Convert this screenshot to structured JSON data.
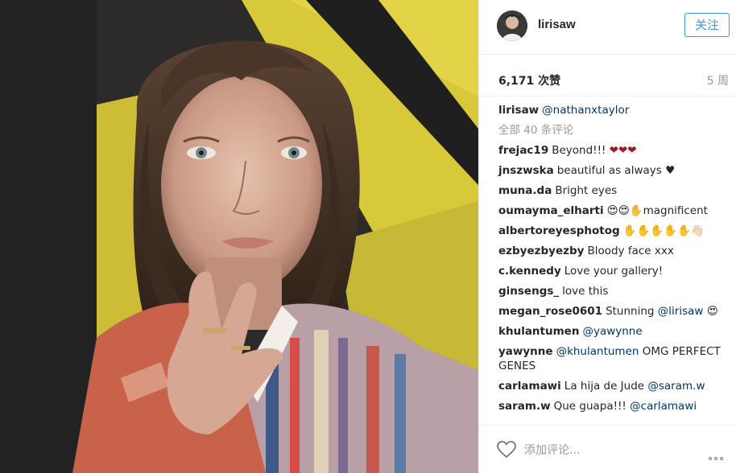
{
  "post": {
    "username": "lirisaw",
    "follow_label": "关注",
    "likes": "6,171 次赞",
    "time": "5 周",
    "caption": {
      "user": "lirisaw",
      "mention": "@nathanxtaylor"
    },
    "load_more": "全部 40 条评论",
    "comments": [
      {
        "user": "frejac19",
        "text": "Beyond!!! ",
        "emoji": "❤❤❤"
      },
      {
        "user": "jnszwska",
        "text": "beautiful as always ",
        "emoji": "♥"
      },
      {
        "user": "muna.da",
        "text": "Bright eyes"
      },
      {
        "user": "oumayma_elharti",
        "text": "😍😍✋magnificent"
      },
      {
        "user": "albertoreyesphotog",
        "text": "✋✋✋✋✋👋🏻"
      },
      {
        "user": "ezbyezbyezby",
        "text": "Bloody face xxx"
      },
      {
        "user": "c.kennedy",
        "text": "Love your gallery!"
      },
      {
        "user": "ginsengs_",
        "text": "love this"
      },
      {
        "user": "megan_rose0601",
        "text": "Stunning ",
        "mention": "@lirisaw",
        "after": " 😍"
      },
      {
        "user": "khulantumen",
        "mention": "@yawynne"
      },
      {
        "user": "yawynne",
        "mention": "@khulantumen",
        "after": " OMG PERFECT GENES"
      },
      {
        "user": "carlamawi",
        "text": "La hija de Jude ",
        "mention": "@saram.w"
      },
      {
        "user": "saram.w",
        "text": "Que guapa!!! ",
        "mention": "@carlamawi"
      }
    ],
    "add_comment_placeholder": "添加评论..."
  },
  "icons": {
    "like": "heart-outline-icon",
    "more": "more-options-icon"
  },
  "colors": {
    "accent": "#3897f0",
    "mention": "#003569",
    "muted": "#999999"
  }
}
